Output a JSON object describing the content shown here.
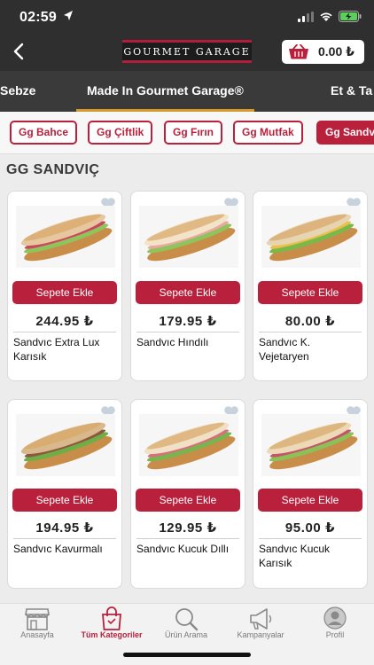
{
  "status_bar": {
    "time": "02:59"
  },
  "header": {
    "logo_text": "GOURMET GARAGE",
    "cart_total": "0.00 ₺"
  },
  "category_tabs": [
    {
      "label": "Sebze",
      "active": false
    },
    {
      "label": "Made In Gourmet Garage®",
      "active": true
    },
    {
      "label": "Et & Ta",
      "active": false
    }
  ],
  "sub_categories": [
    {
      "label": "Gg Bahce",
      "active": false
    },
    {
      "label": "Gg Çiftlik",
      "active": false
    },
    {
      "label": "Gg Fırın",
      "active": false
    },
    {
      "label": "Gg Mutfak",
      "active": false
    },
    {
      "label": "Gg Sandvi",
      "active": true
    }
  ],
  "section": {
    "title": "GG SANDVIÇ"
  },
  "add_to_cart_label": "Sepete Ekle",
  "products": [
    {
      "price": "244.95 ₺",
      "name": "Sandvıc Extra Lux Karısık"
    },
    {
      "price": "179.95 ₺",
      "name": "Sandvıc Hındılı"
    },
    {
      "price": "80.00 ₺",
      "name": "Sandvıc K. Vejetaryen"
    },
    {
      "price": "194.95 ₺",
      "name": "Sandvıc Kavurmalı"
    },
    {
      "price": "129.95 ₺",
      "name": "Sandvıc Kucuk Dıllı"
    },
    {
      "price": "95.00 ₺",
      "name": "Sandvıc Kucuk Karısık"
    }
  ],
  "bottom_nav": [
    {
      "label": "Anasayfa",
      "icon": "storefront-icon",
      "active": false
    },
    {
      "label": "Tüm Kategoriler",
      "icon": "shopping-bag-icon",
      "active": true
    },
    {
      "label": "Ürün Arama",
      "icon": "search-icon",
      "active": false
    },
    {
      "label": "Kampanyalar",
      "icon": "megaphone-icon",
      "active": false
    },
    {
      "label": "Profil",
      "icon": "profile-icon",
      "active": false
    }
  ],
  "colors": {
    "brand": "#b8203c",
    "tab_underline": "#d59a29",
    "header": "#2f2f2f"
  }
}
